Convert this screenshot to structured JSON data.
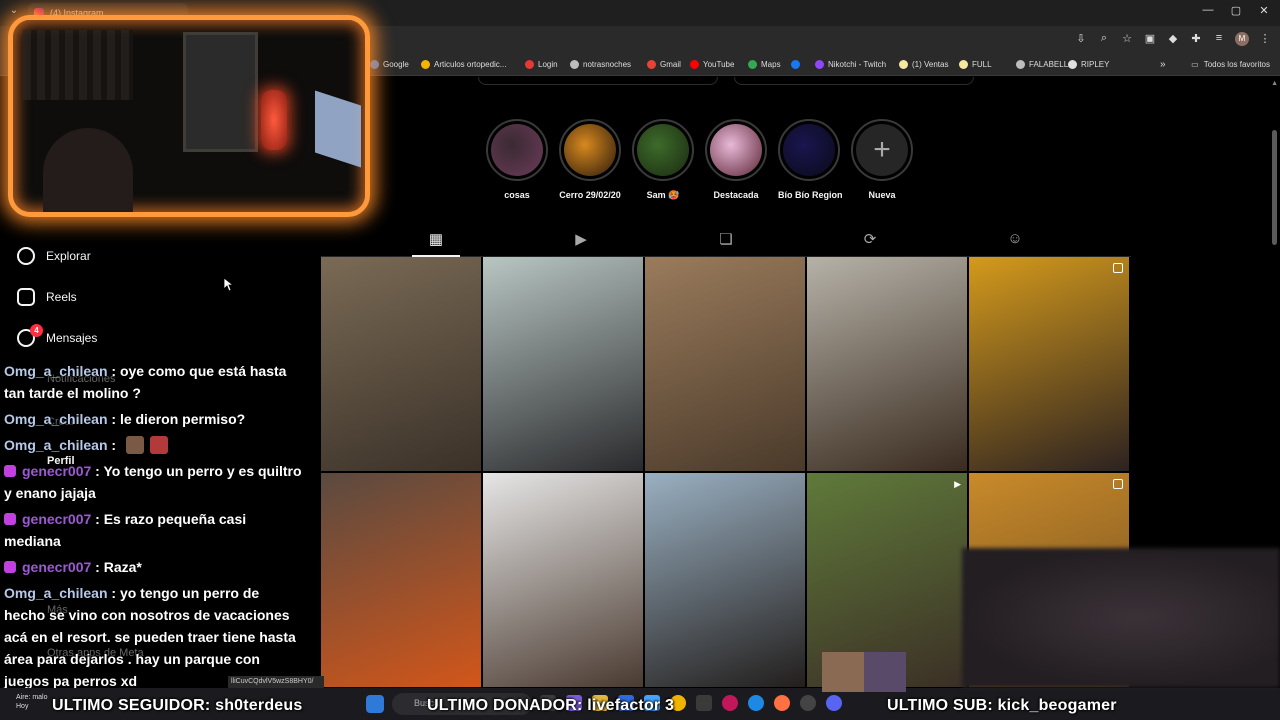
{
  "browser": {
    "tab_title": "(4) Instagram",
    "window_controls": [
      "—",
      "▢",
      "✕"
    ],
    "bookmarks": [
      {
        "label": "Google",
        "color": "#4285f4"
      },
      {
        "label": "Articulos ortopedic...",
        "color": "#f4b400"
      },
      {
        "label": "Login",
        "color": "#e53935"
      },
      {
        "label": "notrasnoches",
        "color": "#bdbdbd"
      },
      {
        "label": "Gmail",
        "color": "#ea4335"
      },
      {
        "label": "YouTube",
        "color": "#ff0000"
      },
      {
        "label": "Maps",
        "color": "#34a853"
      },
      {
        "label": "",
        "color": "#1877f2"
      },
      {
        "label": "Nikotchi - Twitch",
        "color": "#9146ff"
      },
      {
        "label": "(1) Ventas",
        "color": "#f5e6a0"
      },
      {
        "label": "FULL",
        "color": "#f5e6a0"
      },
      {
        "label": "FALABELLA",
        "color": "#bdbdbd"
      },
      {
        "label": "RIPLEY",
        "color": "#e0e0e0"
      }
    ],
    "favorites_label": "Todos los favoritos",
    "profile_initial": "M"
  },
  "instagram": {
    "highlights": [
      {
        "label": "cosas",
        "colors": [
          "#3a2a33",
          "#6b3b58"
        ]
      },
      {
        "label": "Cerro 29/02/20",
        "colors": [
          "#d8891e",
          "#2a1a0c"
        ]
      },
      {
        "label": "Sam 🥵",
        "colors": [
          "#3d6b2a",
          "#1b2a12"
        ]
      },
      {
        "label": "Destacada",
        "colors": [
          "#e8b9d8",
          "#5a2434"
        ]
      },
      {
        "label": "Bío Bío Region",
        "colors": [
          "#1a1650",
          "#0a0a18"
        ]
      },
      {
        "label": "Nueva",
        "colors": []
      }
    ],
    "sidebar": {
      "explore": "Explorar",
      "reels": "Reels",
      "messages": "Mensajes",
      "messages_badge": "4",
      "notifications": "Notificaciones",
      "create": "Crear",
      "profile": "Perfil",
      "more": "Más",
      "meta": "Otras apps de Meta"
    },
    "posts": [
      {
        "colors": [
          "#7a6a55",
          "#3a3128"
        ]
      },
      {
        "colors": [
          "#b8c6c2",
          "#2a2a2d"
        ]
      },
      {
        "colors": [
          "#9a7b5c",
          "#4a3a2a"
        ]
      },
      {
        "colors": [
          "#b6b2a8",
          "#3a2b1f"
        ]
      },
      {
        "colors": [
          "#d49a1c",
          "#2c2220"
        ]
      },
      {
        "colors": [
          "#5a4a40",
          "#d2561a"
        ]
      },
      {
        "colors": [
          "#e6e6e6",
          "#4a3a30"
        ]
      },
      {
        "colors": [
          "#9ab0c2",
          "#221e1c"
        ]
      },
      {
        "colors": [
          "#5f7a3a",
          "#3b2f25"
        ]
      },
      {
        "colors": [
          "#c98a2a",
          "#6a4a20"
        ]
      }
    ]
  },
  "chat": [
    {
      "user": "Omg_a_chilean",
      "style": "u1",
      "badge": false,
      "text": " : oye como que está hasta tan tarde el molino ?"
    },
    {
      "user": "Omg_a_chilean",
      "style": "u1",
      "badge": false,
      "text": " : le dieron permiso?"
    },
    {
      "user": "Omg_a_chilean",
      "style": "u1",
      "badge": false,
      "text": " : "
    },
    {
      "user": "genecr007",
      "style": "u2",
      "badge": true,
      "text": " : Yo tengo un perro y es quiltro y enano jajaja"
    },
    {
      "user": "genecr007",
      "style": "u2",
      "badge": true,
      "text": " : Es razo pequeña casi mediana"
    },
    {
      "user": "genecr007",
      "style": "u2",
      "badge": true,
      "text": " : Raza*"
    },
    {
      "user": "Omg_a_chilean",
      "style": "u1",
      "badge": false,
      "text": " : yo tengo un perro de hecho se vino con nosotros de vacaciones acá en el resort. se pueden traer tiene hasta área para dejarlos . hay un parque con juegos pa perros xd"
    }
  ],
  "overlay": {
    "last_follower": "ULTIMO SEGUIDOR: sh0terdeus",
    "last_donor": "ULTIMO DONADOR: livefactor 3",
    "last_sub": "ULTIMO SUB: kick_beogamer"
  },
  "status_url": "lliCuvCQdvlV5wzS8BHY0/",
  "taskbar": {
    "search_placeholder": "Buscar",
    "weather_line1": "Aire: malo",
    "weather_line2": "Hoy"
  }
}
